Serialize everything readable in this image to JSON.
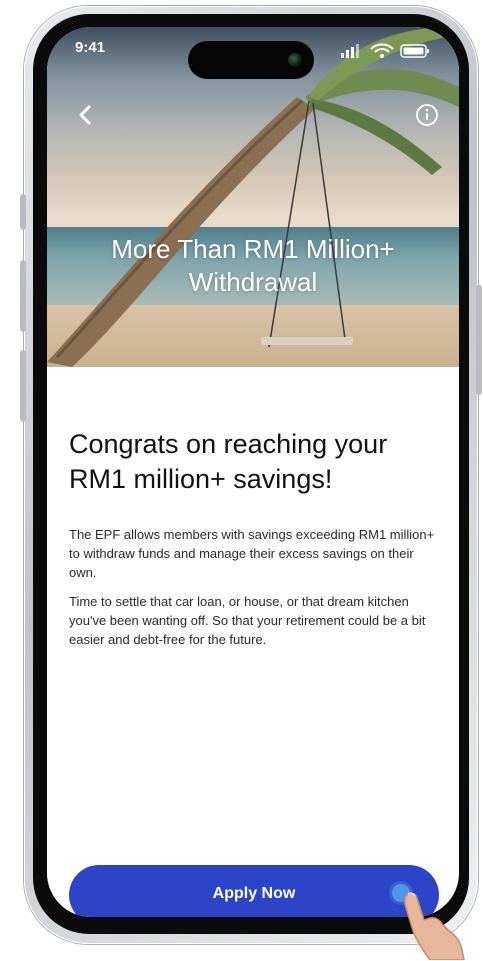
{
  "status_bar": {
    "time": "9:41"
  },
  "hero": {
    "title": "More Than RM1 Million+ Withdrawal"
  },
  "content": {
    "heading": "Congrats on reaching your RM1 million+ savings!",
    "paragraph_1": "The EPF allows members with savings exceeding RM1 million+ to withdraw funds and manage their excess savings on their own.",
    "paragraph_2": "Time to settle that car loan, or house, or that dream kitchen you've been wanting off. So that your retirement could be a bit easier and debt-free for the future."
  },
  "cta": {
    "label": "Apply Now"
  },
  "colors": {
    "primary": "#2b44c8",
    "tap_indicator": "#4c98e6"
  },
  "icons": [
    "back-chevron-icon",
    "info-icon",
    "signal-icon",
    "wifi-icon",
    "battery-icon",
    "tap-hand-icon"
  ]
}
